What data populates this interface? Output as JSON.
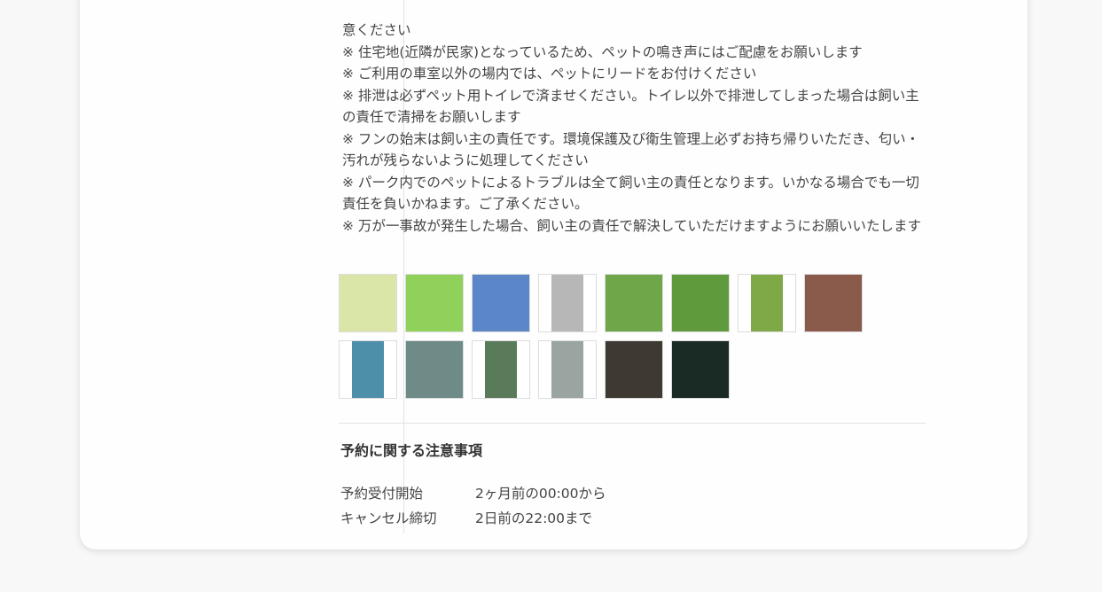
{
  "notes": [
    "意ください",
    "※ 住宅地(近隣が民家)となっているため、ペットの鳴き声にはご配慮をお願いします",
    "※ ご利用の車室以外の場内では、ペットにリードをお付けください",
    "※ 排泄は必ずペット用トイレで済ませください。トイレ以外で排泄してしまった場合は飼い主の責任で清掃をお願いします",
    "※ フンの始末は飼い主の責任です。環境保護及び衛生管理上必ずお持ち帰りいただき、匂い・汚れが残らないように処理してください",
    "※ パーク内でのペットによるトラブルは全て飼い主の責任となります。いかなる場合でも一切責任を負いかねます。ご了承ください。",
    "※ 万が一事故が発生した場合、飼い主の責任で解決していただけますようにお願いいたします"
  ],
  "photos": {
    "row1": [
      {
        "name": "photo-map-board",
        "bg": "#d9e6a8"
      },
      {
        "name": "photo-sign-board",
        "bg": "#8fd15a"
      },
      {
        "name": "photo-sky-fence",
        "bg": "#5b87c9"
      },
      {
        "name": "photo-gate",
        "bg": "#b7b7b7"
      },
      {
        "name": "photo-lawn",
        "bg": "#6fa64a"
      },
      {
        "name": "photo-fence-lawn",
        "bg": "#5f9b3d"
      },
      {
        "name": "photo-turf-path",
        "bg": "#7fa846"
      },
      {
        "name": "photo-gravel",
        "bg": "#8a5a4a"
      }
    ],
    "row2": [
      {
        "name": "photo-water-tap",
        "bg": "#4d8ea8"
      },
      {
        "name": "photo-toilet-booths",
        "bg": "#6e8b88"
      },
      {
        "name": "photo-post",
        "bg": "#5a7b5a"
      },
      {
        "name": "photo-door",
        "bg": "#9aa4a0"
      },
      {
        "name": "photo-night-area",
        "bg": "#3e3a33"
      },
      {
        "name": "photo-night-lights",
        "bg": "#1a2a24"
      }
    ]
  },
  "booking_section": {
    "title": "予約に関する注意事項",
    "rows": [
      {
        "label": "予約受付開始",
        "value": "2ヶ月前の00:00から"
      },
      {
        "label": "キャンセル締切",
        "value": "2日前の22:00まで"
      }
    ]
  }
}
